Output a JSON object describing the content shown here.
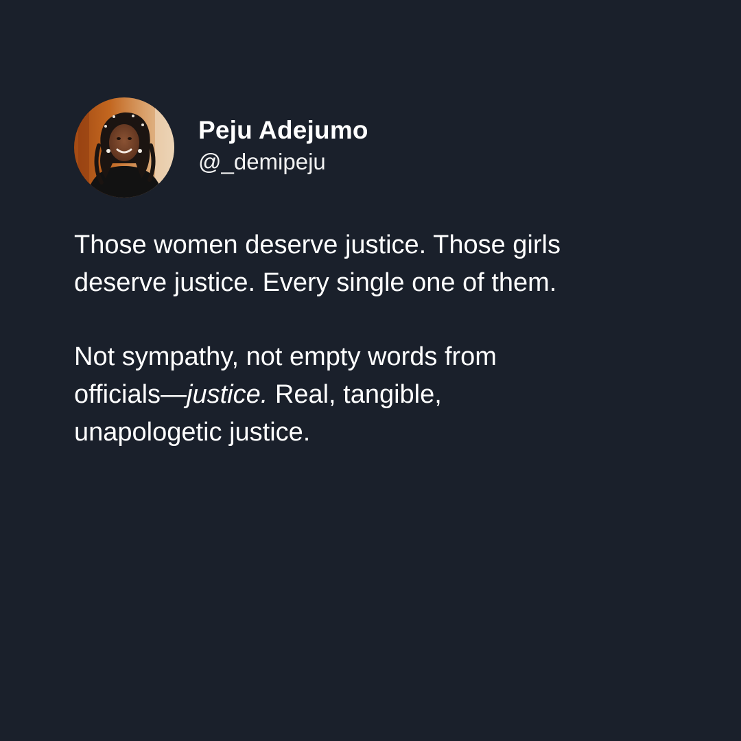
{
  "author": {
    "display_name": "Peju Adejumo",
    "handle": "@_demipeju",
    "avatar_icon": "profile-photo-icon"
  },
  "post": {
    "line_1": "Those women deserve justice. Those girls",
    "line_2": "deserve justice. Every single one of them.",
    "p2_line_1": "Not sympathy, not empty words from",
    "p2_prefix": "officials—",
    "p2_emphasis": "justice.",
    "p2_suffix": " Real, tangible,",
    "p2_line_3": "unapologetic justice."
  },
  "colors": {
    "background": "#1a202b",
    "text": "#ffffff"
  }
}
